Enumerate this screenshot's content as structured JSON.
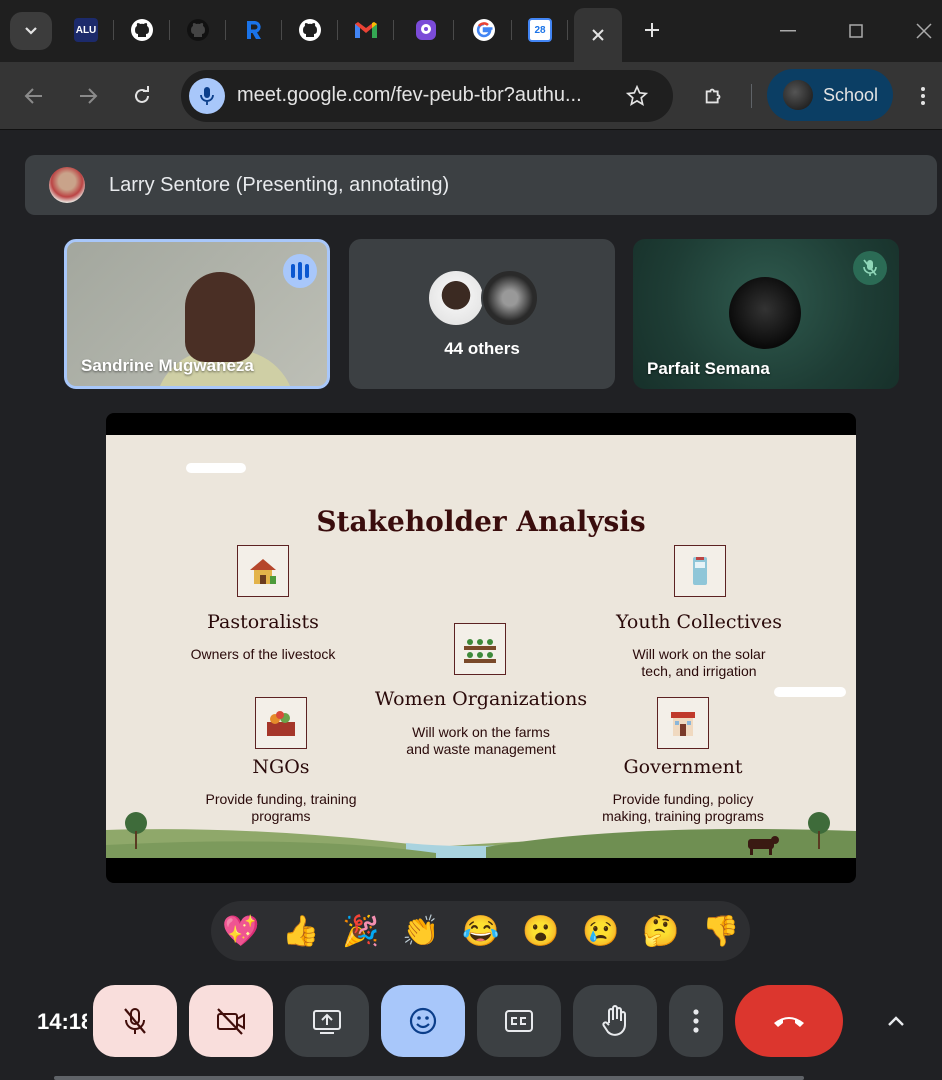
{
  "browser": {
    "tabs": [
      {
        "name": "alu",
        "badge": "ALU"
      },
      {
        "name": "github-1"
      },
      {
        "name": "github-2"
      },
      {
        "name": "r-app"
      },
      {
        "name": "github-3"
      },
      {
        "name": "gmail"
      },
      {
        "name": "chat-app"
      },
      {
        "name": "google"
      },
      {
        "name": "calendar",
        "badge": "28"
      },
      {
        "name": "meet",
        "active": true
      }
    ],
    "url": "meet.google.com/fev-peub-tbr?authu...",
    "profile_label": "School"
  },
  "meet": {
    "presenter_text": "Larry Sentore (Presenting, annotating)",
    "tiles": [
      {
        "name": "Sandrine Mugwaneza",
        "speaking": true
      },
      {
        "label": "44 others"
      },
      {
        "name": "Parfait Semana",
        "muted": true
      }
    ],
    "clock": "14:18",
    "reactions": [
      "💖",
      "👍",
      "🎉",
      "👏",
      "😂",
      "😮",
      "😢",
      "🤔",
      "👎"
    ]
  },
  "slide": {
    "title": "Stakeholder Analysis",
    "stakeholders": {
      "pastoralists": {
        "title": "Pastoralists",
        "desc": "Owners of the livestock"
      },
      "youth": {
        "title": "Youth Collectives",
        "desc_l1": "Will work on the solar",
        "desc_l2": "tech, and irrigation"
      },
      "women": {
        "title": "Women Organizations",
        "desc_l1": "Will work on the farms",
        "desc_l2": "and waste management"
      },
      "ngos": {
        "title": "NGOs",
        "desc_l1": "Provide funding, training",
        "desc_l2": "programs"
      },
      "government": {
        "title": "Government",
        "desc_l1": "Provide funding, policy",
        "desc_l2": "making, training programs"
      }
    }
  },
  "colors": {
    "accent_blue": "#a8c7fa",
    "end_call_red": "#dc362e",
    "slide_bg": "#ece6dc",
    "slide_title": "#3a0d0d"
  }
}
